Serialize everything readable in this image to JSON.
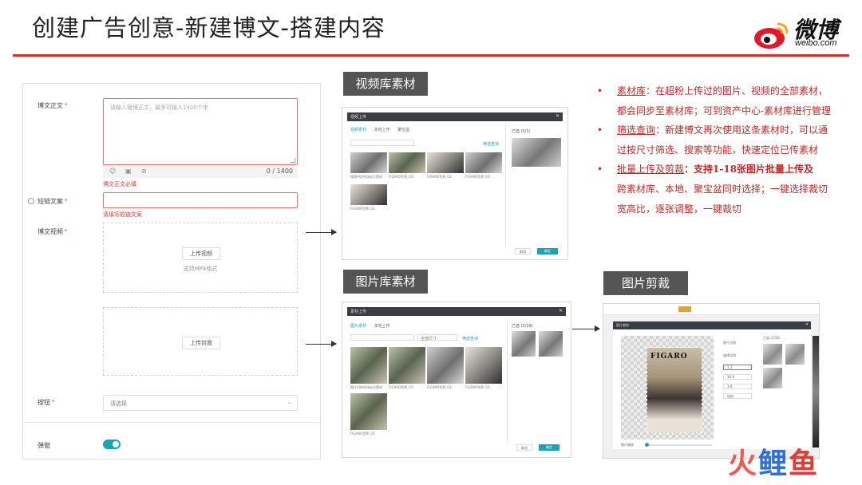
{
  "slide": {
    "title": "创建广告创意-新建博文-搭建内容",
    "logo": {
      "brand": "微博",
      "sub": "weibo.com"
    }
  },
  "form": {
    "text_label": "博文正文",
    "required_mark": "*",
    "text_placeholder": "请输入微博正文，最多可输入1400个字",
    "counter": "0 / 1400",
    "text_error": "博文正文必填",
    "short_label": "短链文案",
    "short_error": "请填写短链文案",
    "video_label": "博文视频",
    "upload_video_btn": "上传视频",
    "upload_video_hint": "支持MP4格式",
    "upload_cover_btn": "上传封面",
    "button_label": "按钮",
    "select_placeholder": "请选择",
    "toggle_label": "弹窗"
  },
  "tags": {
    "video_lib": "视频库素材",
    "image_lib": "图片库素材",
    "image_crop": "图片剪裁"
  },
  "video_window": {
    "title": "视频上传",
    "tabs": [
      "视频素材",
      "本地上传",
      "聚宝盆"
    ],
    "search_link": "筛选查询",
    "side_title": "已选 (0/1)",
    "captions": [
      "视频时尚秀场走位素材",
      "FIGARO世界_03",
      "FIGARO世界_03",
      "FIGARO世界_03",
      "FIGARO世界_03"
    ],
    "cancel": "取消",
    "ok": "确定"
  },
  "image_window": {
    "title": "素材上传",
    "tabs": [
      "图片素材",
      "本地上传"
    ],
    "size_select": "全部尺寸",
    "search_link": "筛选查询",
    "side_title": "已选 (2/18)",
    "captions": [
      "图片时尚秀场走位素材",
      "FIGARO世界_03",
      "FIGARO世界_03",
      "FIGARO世界_03",
      "FIGARO世界_03"
    ],
    "cancel": "取消",
    "ok": "确定"
  },
  "crop_window": {
    "modal_title": "图片裁剪",
    "magazine": "FIGARO",
    "side_title": "已选 (2/18)",
    "ratios": [
      "1:1",
      "16:9",
      "3:4",
      "自由"
    ],
    "opt1": "图片比例",
    "opt2": "选择比例",
    "zoom_label": "图片缩放"
  },
  "notes": [
    {
      "keyword": "素材库",
      "text": "：在超粉上传过的图片、视频的全部素材，都会同步至素材库；可到资产中心-素材库进行管理"
    },
    {
      "keyword": "筛选查询",
      "text": "：新建博文再次使用这条素材时，可以通过按尺寸筛选、搜索等功能，快速定位已传素材"
    },
    {
      "keyword": "批量上传及剪裁",
      "lead": "：支持1-18张图片批量上传及",
      "text": "跨素材库、本地、聚宝盆同时选择；一键选择裁切宽高比，逐张调整，一键裁切"
    }
  ],
  "watermark": {
    "c1": "火",
    "c2": "鲤",
    "c3": "鱼"
  },
  "colors": {
    "accent": "#1aa3b2",
    "brand_red": "#d9312c",
    "note_red": "#c62828"
  }
}
